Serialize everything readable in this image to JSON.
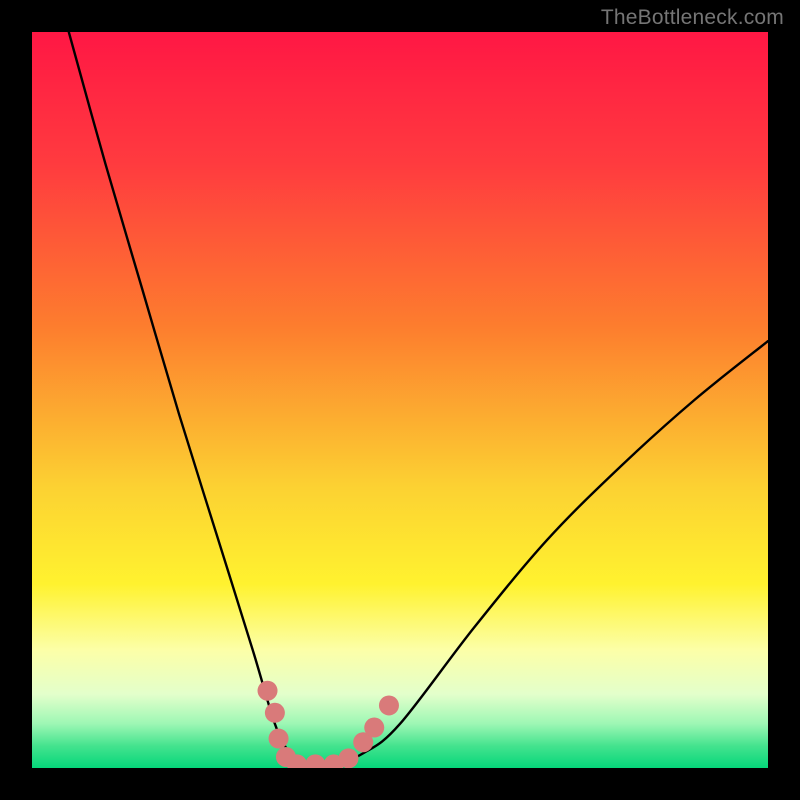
{
  "watermark": "TheBottleneck.com",
  "chart_data": {
    "type": "line",
    "title": "",
    "xlabel": "",
    "ylabel": "",
    "xlim": [
      0,
      100
    ],
    "ylim": [
      0,
      100
    ],
    "grid": false,
    "legend": false,
    "series": [
      {
        "name": "bottleneck-curve",
        "x": [
          5,
          10,
          15,
          20,
          25,
          30,
          33,
          35,
          37,
          40,
          45,
          50,
          60,
          70,
          80,
          90,
          100
        ],
        "y": [
          100,
          82,
          65,
          48,
          32,
          16,
          6,
          2,
          0,
          0,
          2,
          6,
          19,
          31,
          41,
          50,
          58
        ]
      }
    ],
    "markers": {
      "name": "highlighted-points",
      "color": "#d97a7a",
      "points": [
        {
          "x": 32.0,
          "y": 10.5
        },
        {
          "x": 33.0,
          "y": 7.5
        },
        {
          "x": 33.5,
          "y": 4.0
        },
        {
          "x": 34.5,
          "y": 1.5
        },
        {
          "x": 36.0,
          "y": 0.5
        },
        {
          "x": 38.5,
          "y": 0.5
        },
        {
          "x": 41.0,
          "y": 0.5
        },
        {
          "x": 43.0,
          "y": 1.3
        },
        {
          "x": 45.0,
          "y": 3.5
        },
        {
          "x": 46.5,
          "y": 5.5
        },
        {
          "x": 48.5,
          "y": 8.5
        }
      ]
    },
    "background_gradient": {
      "stops": [
        {
          "pct": 0,
          "color": "#ff1744"
        },
        {
          "pct": 18,
          "color": "#ff3b3f"
        },
        {
          "pct": 40,
          "color": "#fd7d2e"
        },
        {
          "pct": 62,
          "color": "#fcd232"
        },
        {
          "pct": 75,
          "color": "#fff22f"
        },
        {
          "pct": 84,
          "color": "#fcffa8"
        },
        {
          "pct": 90,
          "color": "#e3ffcb"
        },
        {
          "pct": 94,
          "color": "#9df7b4"
        },
        {
          "pct": 97,
          "color": "#44e38e"
        },
        {
          "pct": 100,
          "color": "#05d67a"
        }
      ]
    }
  }
}
